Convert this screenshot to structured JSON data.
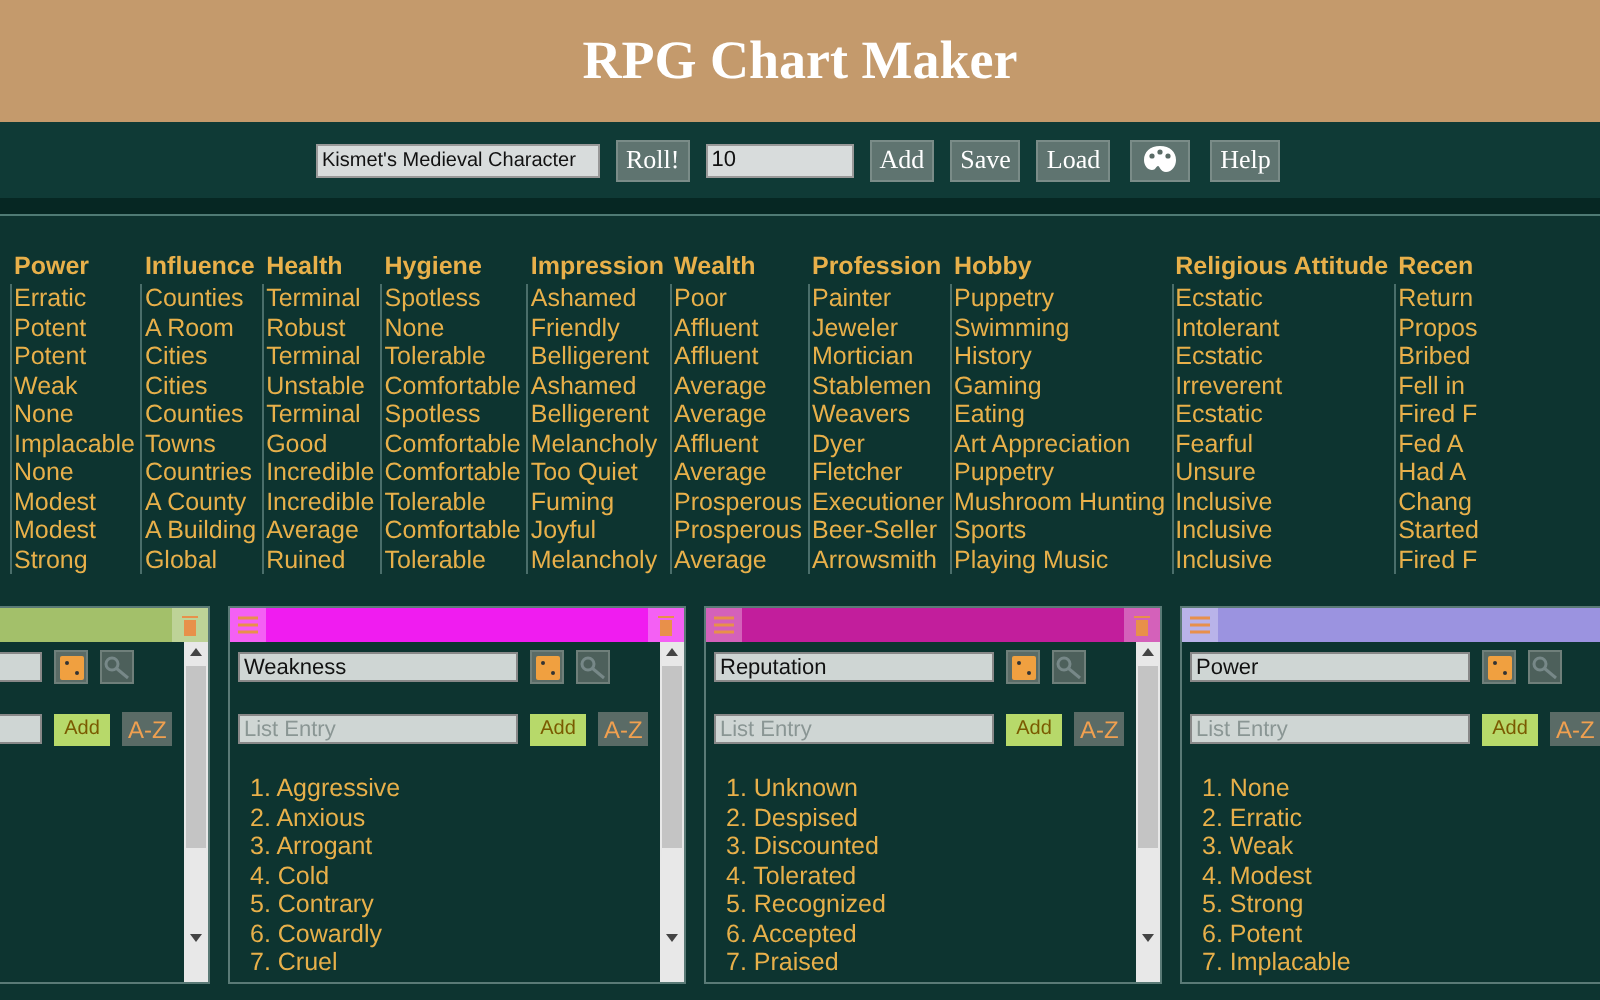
{
  "title": "RPG Chart Maker",
  "toolbar": {
    "chart_name": "Kismet's Medieval Character",
    "roll_button": "Roll!",
    "count": "10",
    "buttons": [
      "Add",
      "Save",
      "Load"
    ],
    "help_button": "Help"
  },
  "table": {
    "columns": [
      {
        "heading": "Power",
        "cells": [
          "Erratic",
          "Potent",
          "Potent",
          "Weak",
          "None",
          "Implacable",
          "None",
          "Modest",
          "Modest",
          "Strong"
        ]
      },
      {
        "heading": "Influence",
        "cells": [
          "Counties",
          "A Room",
          "Cities",
          "Cities",
          "Counties",
          "Towns",
          "Countries",
          "A County",
          "A Building",
          "Global"
        ]
      },
      {
        "heading": "Health",
        "cells": [
          "Terminal",
          "Robust",
          "Terminal",
          "Unstable",
          "Terminal",
          "Good",
          "Incredible",
          "Incredible",
          "Average",
          "Ruined"
        ]
      },
      {
        "heading": "Hygiene",
        "cells": [
          "Spotless",
          "None",
          "Tolerable",
          "Comfortable",
          "Spotless",
          "Comfortable",
          "Comfortable",
          "Tolerable",
          "Comfortable",
          "Tolerable"
        ]
      },
      {
        "heading": "Impression",
        "cells": [
          "Ashamed",
          "Friendly",
          "Belligerent",
          "Ashamed",
          "Belligerent",
          "Melancholy",
          "Too Quiet",
          "Fuming",
          "Joyful",
          "Melancholy"
        ]
      },
      {
        "heading": "Wealth",
        "cells": [
          "Poor",
          "Affluent",
          "Affluent",
          "Average",
          "Average",
          "Affluent",
          "Average",
          "Prosperous",
          "Prosperous",
          "Average"
        ]
      },
      {
        "heading": "Profession",
        "cells": [
          "Painter",
          "Jeweler",
          "Mortician",
          "Stablemen",
          "Weavers",
          "Dyer",
          "Fletcher",
          "Executioner",
          "Beer-Seller",
          "Arrowsmith"
        ]
      },
      {
        "heading": "Hobby",
        "cells": [
          "Puppetry",
          "Swimming",
          "History",
          "Gaming",
          "Eating",
          "Art Appreciation",
          "Puppetry",
          "Mushroom Hunting",
          "Sports",
          "Playing Music"
        ]
      },
      {
        "heading": "Religious Attitude",
        "cells": [
          "Ecstatic",
          "Intolerant",
          "Ecstatic",
          "Irreverent",
          "Ecstatic",
          "Fearful",
          "Unsure",
          "Inclusive",
          "Inclusive",
          "Inclusive"
        ]
      },
      {
        "heading": "Recen",
        "cells": [
          "Return",
          "Propos",
          "Bribed",
          "Fell in",
          "Fired F",
          "Fed A",
          "Had A",
          "Chang",
          "Started",
          "Fired F"
        ]
      }
    ]
  },
  "panels": [
    {
      "color": "#a3c06a",
      "add_button": "Add",
      "sort_button": "A-Z"
    },
    {
      "color": "#f01cf0",
      "name": "Weakness",
      "placeholder": "List Entry",
      "add_button": "Add",
      "sort_button": "A-Z",
      "items": [
        "1. Aggressive",
        "2. Anxious",
        "3. Arrogant",
        "4. Cold",
        "5. Contrary",
        "6. Cowardly",
        "7. Cruel"
      ]
    },
    {
      "color": "#c21e9c",
      "name": "Reputation",
      "placeholder": "List Entry",
      "add_button": "Add",
      "sort_button": "A-Z",
      "items": [
        "1. Unknown",
        "2. Despised",
        "3. Discounted",
        "4. Tolerated",
        "5. Recognized",
        "6. Accepted",
        "7. Praised"
      ]
    },
    {
      "color": "#9b93e0",
      "name": "Power",
      "placeholder": "List Entry",
      "add_button": "Add",
      "sort_button": "A-Z",
      "items": [
        "1. None",
        "2. Erratic",
        "3. Weak",
        "4. Modest",
        "5. Strong",
        "6. Potent",
        "7. Implacable"
      ]
    }
  ]
}
